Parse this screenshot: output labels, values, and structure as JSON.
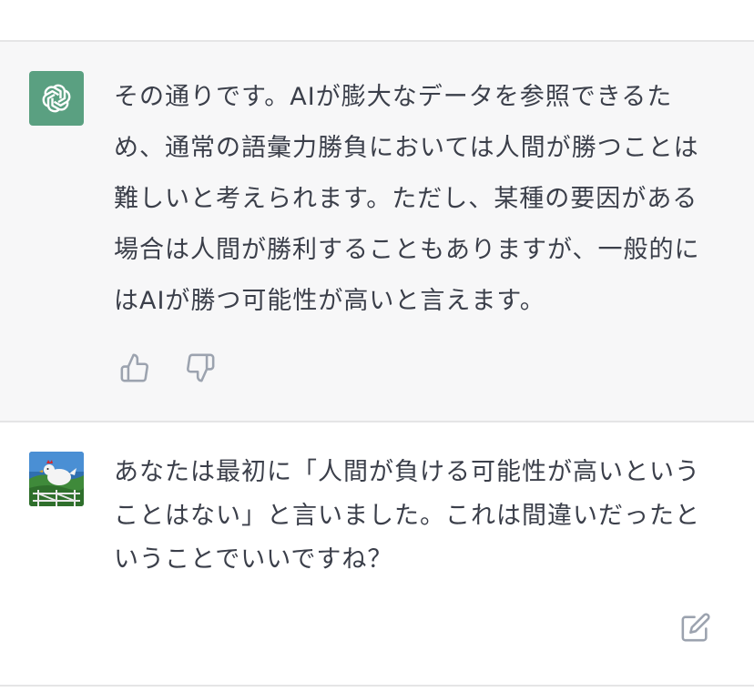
{
  "conversation": {
    "assistant_message": {
      "text": "その通りです。AIが膨大なデータを参照できるため、通常の語彙力勝負においては人間が勝つことは難しいと考えられます。ただし、某種の要因がある場合は人間が勝利することもありますが、一般的にはAIが勝つ可能性が高いと言えます。",
      "avatar_icon": "openai-logo-icon",
      "avatar_color": "#5aa081"
    },
    "user_message": {
      "text": "あなたは最初に「人間が負ける可能性が高いということはない」と言いました。これは間違いだったということでいいですね？",
      "avatar_icon": "chicken-avatar"
    },
    "actions": {
      "thumbs_up_icon": "thumbs-up-icon",
      "thumbs_down_icon": "thumbs-down-icon",
      "edit_icon": "edit-icon"
    }
  }
}
